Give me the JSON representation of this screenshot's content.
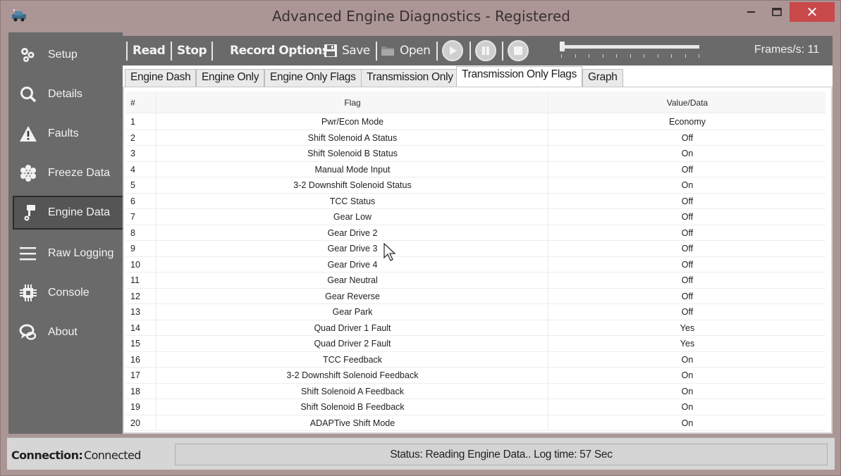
{
  "window": {
    "title": "Advanced Engine Diagnostics - Registered",
    "app_icon": "car-icon",
    "controls": {
      "minimize": "–",
      "maximize": "□",
      "close": "✕"
    },
    "colors": {
      "frame": "#ab9695",
      "close_button": "#c9494a",
      "sidebar": "#6a6a6a"
    }
  },
  "sidebar": {
    "items": [
      {
        "label": "Setup",
        "icon": "gears-icon"
      },
      {
        "label": "Details",
        "icon": "magnifier-icon"
      },
      {
        "label": "Faults",
        "icon": "warning-icon"
      },
      {
        "label": "Freeze Data",
        "icon": "snowflake-icon"
      },
      {
        "label": "Engine Data",
        "icon": "piston-icon",
        "active": true
      },
      {
        "label": "Raw Logging",
        "icon": "lines-icon"
      },
      {
        "label": "Console",
        "icon": "chip-icon"
      },
      {
        "label": "About",
        "icon": "chat-bubbles-icon"
      }
    ]
  },
  "toolbar": {
    "read_label": "Read",
    "stop_label": "Stop",
    "record_options_label": "Record Options:",
    "save_label": "Save",
    "open_label": "Open",
    "play_icon": "play-icon",
    "pause_icon": "pause-icon",
    "stop_icon": "stop-icon",
    "playback_position": 0,
    "frames_label": "Frames/s: 11"
  },
  "tabs": [
    {
      "label": "Engine Dash"
    },
    {
      "label": "Engine Only"
    },
    {
      "label": "Engine Only Flags"
    },
    {
      "label": "Transmission Only"
    },
    {
      "label": "Transmission Only Flags",
      "active": true
    },
    {
      "label": "Graph"
    }
  ],
  "table": {
    "columns": [
      "#",
      "Flag",
      "Value/Data"
    ],
    "rows": [
      {
        "num": "1",
        "flag": "Pwr/Econ Mode",
        "value": "Economy"
      },
      {
        "num": "2",
        "flag": "Shift Solenoid A Status",
        "value": "Off"
      },
      {
        "num": "3",
        "flag": "Shift Solenoid B Status",
        "value": "On"
      },
      {
        "num": "4",
        "flag": "Manual Mode Input",
        "value": "Off"
      },
      {
        "num": "5",
        "flag": "3-2 Downshift Solenoid Status",
        "value": "On"
      },
      {
        "num": "6",
        "flag": "TCC Status",
        "value": "Off"
      },
      {
        "num": "7",
        "flag": "Gear Low",
        "value": "Off"
      },
      {
        "num": "8",
        "flag": "Gear Drive 2",
        "value": "Off"
      },
      {
        "num": "9",
        "flag": "Gear Drive 3",
        "value": "Off"
      },
      {
        "num": "10",
        "flag": "Gear Drive 4",
        "value": "Off"
      },
      {
        "num": "11",
        "flag": "Gear Neutral",
        "value": "Off"
      },
      {
        "num": "12",
        "flag": "Gear Reverse",
        "value": "Off"
      },
      {
        "num": "13",
        "flag": "Gear Park",
        "value": "Off"
      },
      {
        "num": "14",
        "flag": "Quad Driver 1 Fault",
        "value": "Yes"
      },
      {
        "num": "15",
        "flag": "Quad Driver 2 Fault",
        "value": "Yes"
      },
      {
        "num": "16",
        "flag": "TCC Feedback",
        "value": "On"
      },
      {
        "num": "17",
        "flag": "3-2 Downshift Solenoid Feedback",
        "value": "On"
      },
      {
        "num": "18",
        "flag": "Shift Solenoid A Feedback",
        "value": "On"
      },
      {
        "num": "19",
        "flag": "Shift Solenoid B Feedback",
        "value": "On"
      },
      {
        "num": "20",
        "flag": "ADAPTive Shift Mode",
        "value": "On"
      }
    ]
  },
  "statusbar": {
    "connection_label": "Connection:",
    "connection_value": "Connected",
    "status_text": "Status: Reading Engine Data..  Log time: 57 Sec"
  }
}
